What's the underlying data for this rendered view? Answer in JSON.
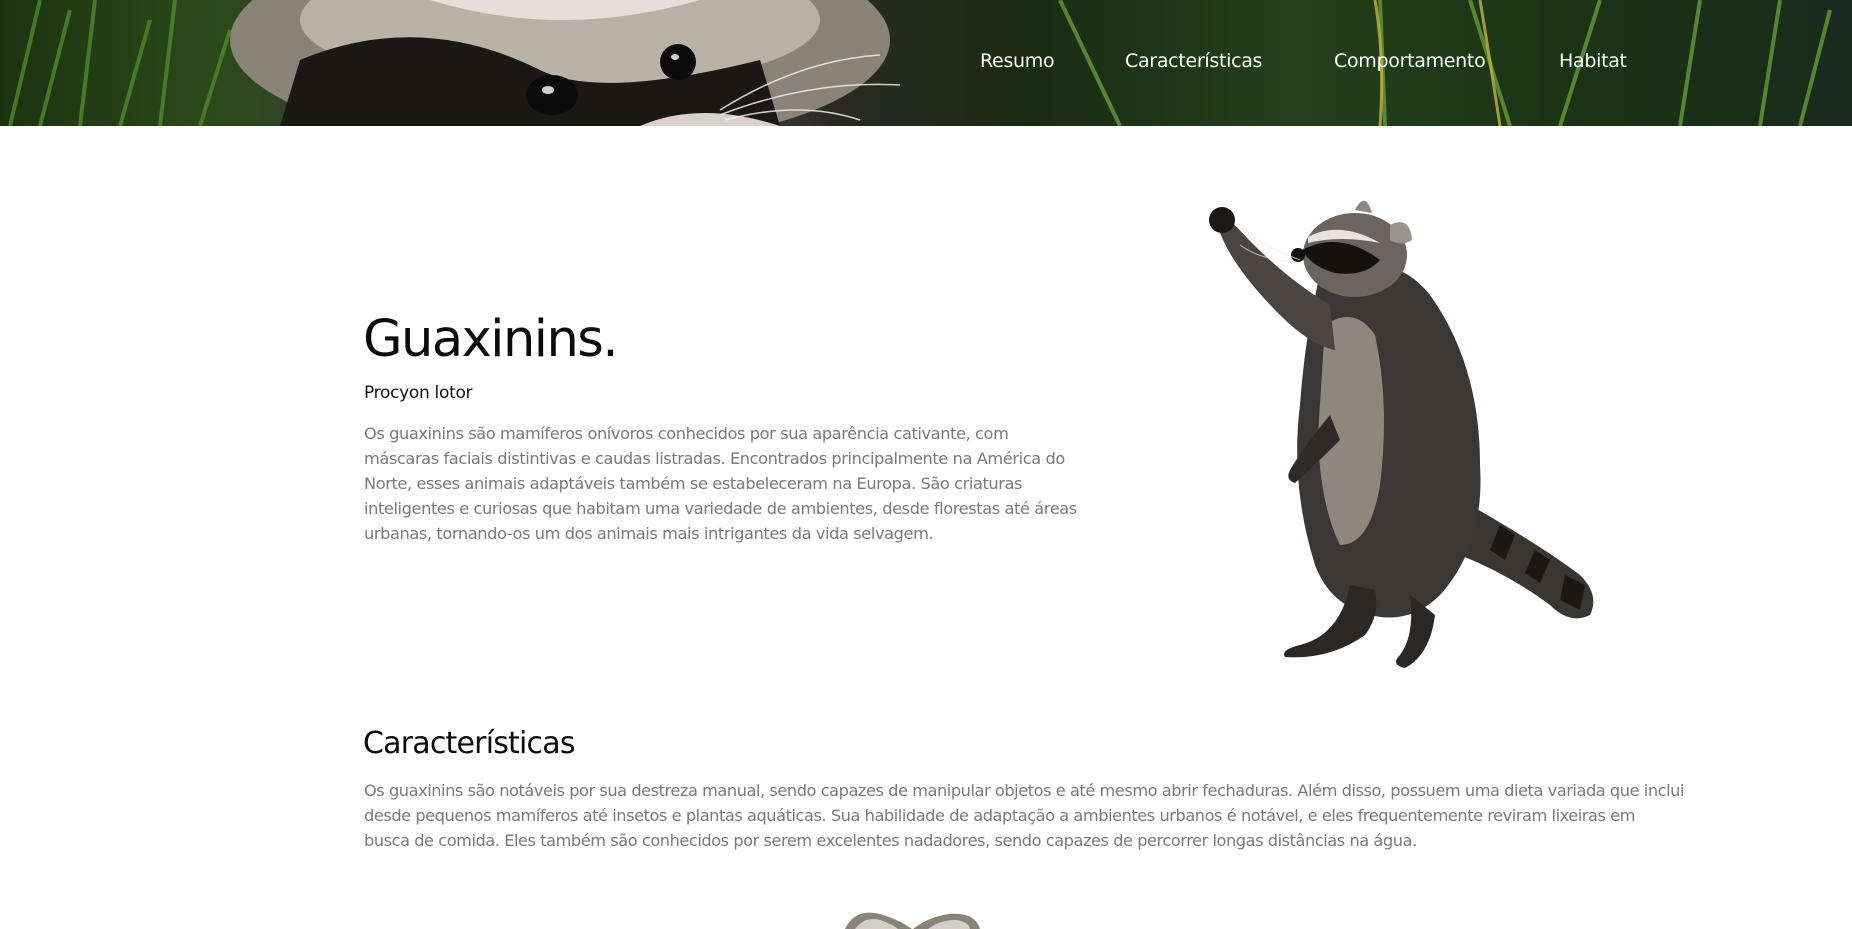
{
  "nav": {
    "items": [
      "Resumo",
      "Características",
      "Comportamento",
      "Habitat"
    ]
  },
  "hero": {
    "title": "Guaxinins.",
    "scientific_name": "Procyon lotor",
    "description": "Os guaxinins são mamíferos onívoros conhecidos por sua aparência cativante, com máscaras faciais distintivas e caudas listradas. Encontrados principalmente na América do Norte, esses animais adaptáveis também se estabeleceram na Europa. São criaturas inteligentes e curiosas que habitam uma variedade de ambientes, desde florestas até áreas urbanas, tornando-os um dos animais mais intrigantes da vida selvagem."
  },
  "characteristics": {
    "title": "Características",
    "text": "Os guaxinins são notáveis por sua destreza manual, sendo capazes de manipular objetos e até mesmo abrir fechaduras. Além disso, possuem uma dieta variada que inclui desde pequenos mamíferos até insetos e plantas aquáticas. Sua habilidade de adaptação a ambientes urbanos é notável, e eles frequentemente reviram lixeiras em busca de comida. Eles também são conhecidos por serem excelentes nadadores, sendo capazes de percorrer longas distâncias na água."
  },
  "colors": {
    "nav_text": "#ffffff",
    "title": "#0b0b0b",
    "body_text": "#7a7a7a",
    "background": "#ffffff"
  },
  "images": {
    "banner": "raccoon-face-photo",
    "hero": "standing-raccoon-photo",
    "bottom": "raccoon-ears-photo"
  }
}
